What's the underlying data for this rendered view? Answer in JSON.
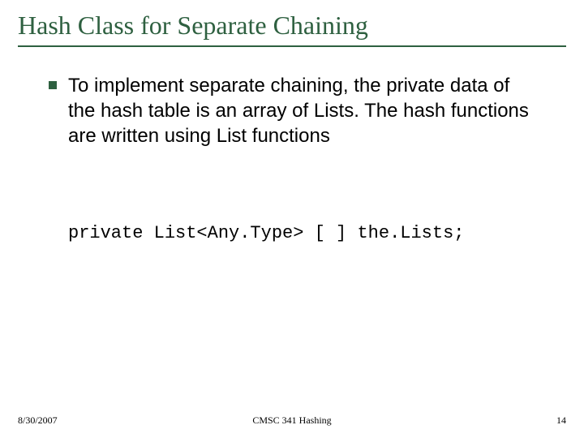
{
  "title": "Hash Class for Separate Chaining",
  "bullets": [
    "To implement separate chaining, the private data of the hash table is an array of Lists. The hash functions are written using List functions"
  ],
  "code": "private List<Any.Type> [ ] the.Lists;",
  "footer": {
    "date": "8/30/2007",
    "course": "CMSC 341 Hashing",
    "page": "14"
  }
}
